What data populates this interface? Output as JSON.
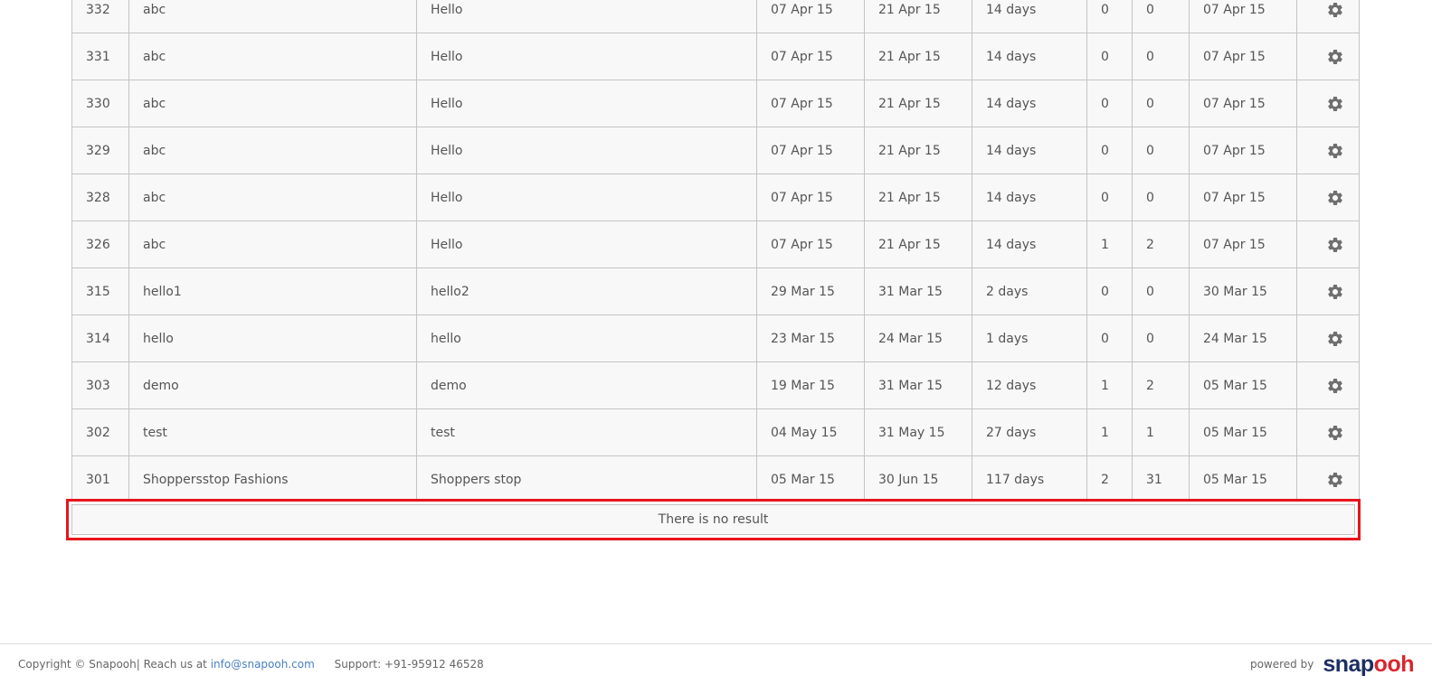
{
  "table": {
    "rows": [
      {
        "id": "332",
        "name": "abc",
        "description": "Hello",
        "start": "07 Apr 15",
        "end": "21 Apr 15",
        "duration": "14 days",
        "count_a": "0",
        "count_b": "0",
        "created": "07 Apr 15"
      },
      {
        "id": "331",
        "name": "abc",
        "description": "Hello",
        "start": "07 Apr 15",
        "end": "21 Apr 15",
        "duration": "14 days",
        "count_a": "0",
        "count_b": "0",
        "created": "07 Apr 15"
      },
      {
        "id": "330",
        "name": "abc",
        "description": "Hello",
        "start": "07 Apr 15",
        "end": "21 Apr 15",
        "duration": "14 days",
        "count_a": "0",
        "count_b": "0",
        "created": "07 Apr 15"
      },
      {
        "id": "329",
        "name": "abc",
        "description": "Hello",
        "start": "07 Apr 15",
        "end": "21 Apr 15",
        "duration": "14 days",
        "count_a": "0",
        "count_b": "0",
        "created": "07 Apr 15"
      },
      {
        "id": "328",
        "name": "abc",
        "description": "Hello",
        "start": "07 Apr 15",
        "end": "21 Apr 15",
        "duration": "14 days",
        "count_a": "0",
        "count_b": "0",
        "created": "07 Apr 15"
      },
      {
        "id": "326",
        "name": "abc",
        "description": "Hello",
        "start": "07 Apr 15",
        "end": "21 Apr 15",
        "duration": "14 days",
        "count_a": "1",
        "count_b": "2",
        "created": "07 Apr 15"
      },
      {
        "id": "315",
        "name": "hello1",
        "description": "hello2",
        "start": "29 Mar 15",
        "end": "31 Mar 15",
        "duration": "2 days",
        "count_a": "0",
        "count_b": "0",
        "created": "30 Mar 15"
      },
      {
        "id": "314",
        "name": "hello",
        "description": "hello",
        "start": "23 Mar 15",
        "end": "24 Mar 15",
        "duration": "1 days",
        "count_a": "0",
        "count_b": "0",
        "created": "24 Mar 15"
      },
      {
        "id": "303",
        "name": "demo",
        "description": "demo",
        "start": "19 Mar 15",
        "end": "31 Mar 15",
        "duration": "12 days",
        "count_a": "1",
        "count_b": "2",
        "created": "05 Mar 15"
      },
      {
        "id": "302",
        "name": "test",
        "description": "test",
        "start": "04 May 15",
        "end": "31 May 15",
        "duration": "27 days",
        "count_a": "1",
        "count_b": "1",
        "created": "05 Mar 15"
      },
      {
        "id": "301",
        "name": "Shoppersstop Fashions",
        "description": "Shoppers stop",
        "start": "05 Mar 15",
        "end": "30 Jun 15",
        "duration": "117 days",
        "count_a": "2",
        "count_b": "31",
        "created": "05 Mar 15"
      }
    ],
    "row_action_icon": "gear-icon",
    "no_result_text": "There is no result"
  },
  "footer": {
    "copyright": "Copyright © Snapooh| Reach us at",
    "email": "info@snapooh.com",
    "support": "Support: +91-95912 46528",
    "powered_by": "powered by",
    "logo_text_part1": "snap",
    "logo_text_part2": "ooh"
  },
  "colors": {
    "highlight_border": "#e8141c",
    "link": "#4a7fc1",
    "logo_dark": "#1d2f63",
    "logo_red": "#d9262e",
    "icon_gray": "#6f6f6f"
  }
}
